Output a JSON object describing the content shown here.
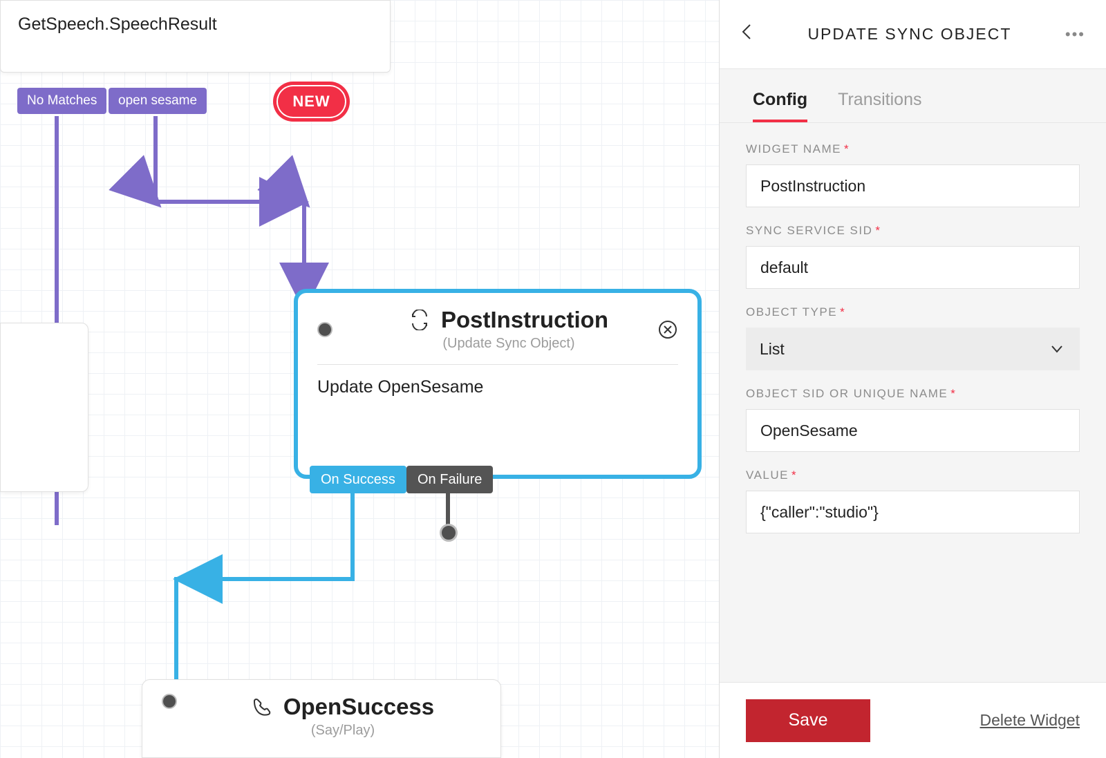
{
  "topWidget": {
    "label": "GetSpeech.SpeechResult",
    "outputs": [
      "No Matches",
      "open sesame"
    ],
    "newBadge": "NEW"
  },
  "postInstruction": {
    "title": "PostInstruction",
    "subtitle": "(Update Sync Object)",
    "body": "Update OpenSesame",
    "outputs": {
      "success": "On Success",
      "failure": "On Failure"
    }
  },
  "openSuccess": {
    "title": "OpenSuccess",
    "subtitle": "(Say/Play)"
  },
  "panel": {
    "title": "UPDATE SYNC OBJECT",
    "tabs": {
      "config": "Config",
      "transitions": "Transitions"
    },
    "fields": {
      "widgetName": {
        "label": "WIDGET NAME",
        "value": "PostInstruction"
      },
      "syncServiceSid": {
        "label": "SYNC SERVICE SID",
        "value": "default"
      },
      "objectType": {
        "label": "OBJECT TYPE",
        "value": "List"
      },
      "objectSid": {
        "label": "OBJECT SID OR UNIQUE NAME",
        "value": "OpenSesame"
      },
      "value": {
        "label": "VALUE",
        "value": "{\"caller\":\"studio\"}"
      }
    },
    "save": "Save",
    "delete": "Delete Widget"
  }
}
